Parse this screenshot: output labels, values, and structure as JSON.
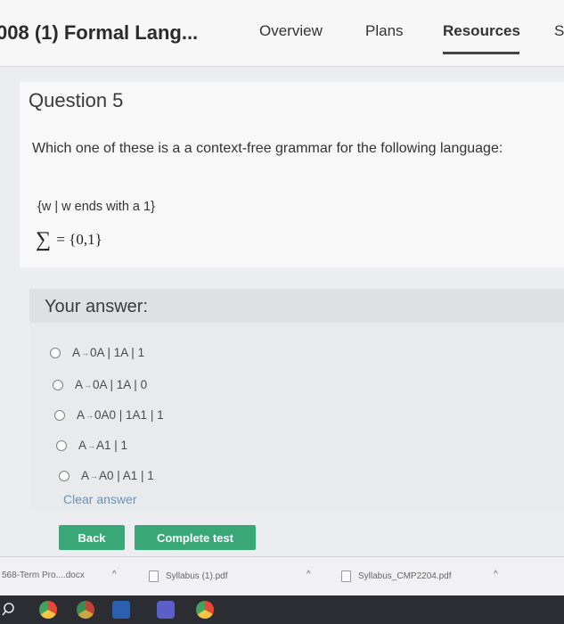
{
  "header": {
    "course_title": "008 (1) Formal Lang...",
    "tabs": [
      {
        "label": "Overview"
      },
      {
        "label": "Plans"
      },
      {
        "label": "Resources"
      },
      {
        "label": "S"
      }
    ],
    "active_tab": "Resources"
  },
  "question": {
    "title": "Question 5",
    "prompt": "Which one of these is a a context-free grammar for the following language:",
    "language": "{w | w ends with a 1}",
    "alphabet_symbol": "∑",
    "alphabet_value": "= {0,1}"
  },
  "answer": {
    "heading": "Your answer:",
    "options": [
      {
        "lhs": "A",
        "arrow": "→",
        "rhs": "0A | 1A | 1"
      },
      {
        "lhs": "A",
        "arrow": "→",
        "rhs": "0A | 1A | 0"
      },
      {
        "lhs": "A",
        "arrow": "→",
        "rhs": "0A0 | 1A1 | 1"
      },
      {
        "lhs": "A",
        "arrow": "→",
        "rhs": "A1 | 1"
      },
      {
        "lhs": "A",
        "arrow": "→",
        "rhs": "A0 | A1 | 1"
      }
    ],
    "clear_label": "Clear answer"
  },
  "buttons": {
    "back": "Back",
    "complete": "Complete test"
  },
  "downloads": [
    {
      "name": "568-Term Pro....docx"
    },
    {
      "name": "Syllabus (1).pdf"
    },
    {
      "name": "Syllabus_CMP2204.pdf"
    }
  ],
  "colors": {
    "accent_green": "#3aa779",
    "link_blue": "#6b8fb4",
    "taskbar": "#2b2d33"
  },
  "taskbar_icons": [
    "search-icon",
    "chrome-icon",
    "chrome-icon",
    "word-icon",
    "teams-icon",
    "chrome-icon"
  ]
}
